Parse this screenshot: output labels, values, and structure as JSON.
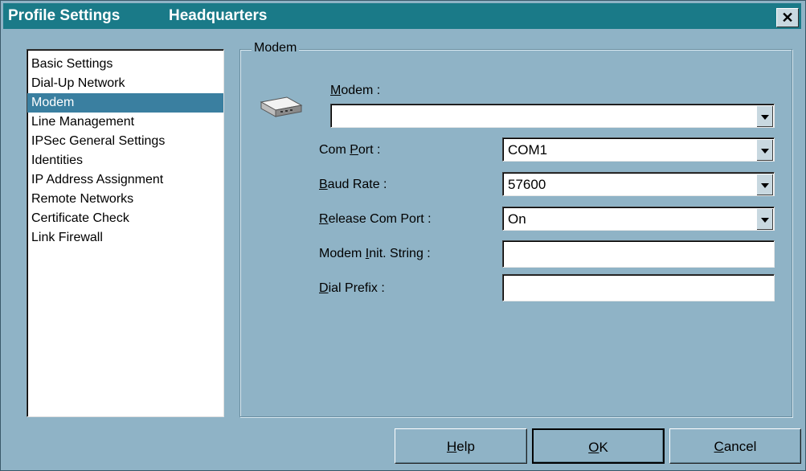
{
  "window": {
    "title_left": "Profile Settings",
    "title_right": "Headquarters",
    "close_glyph": "✕"
  },
  "nav": {
    "items": [
      {
        "label": "Basic Settings"
      },
      {
        "label": "Dial-Up Network"
      },
      {
        "label": "Modem",
        "selected": true
      },
      {
        "label": "Line Management"
      },
      {
        "label": "IPSec General Settings"
      },
      {
        "label": "Identities"
      },
      {
        "label": "IP Address Assignment"
      },
      {
        "label": "Remote Networks"
      },
      {
        "label": "Certificate Check"
      },
      {
        "label": "Link Firewall"
      }
    ]
  },
  "modem_group": {
    "title": "Modem",
    "icon": "modem-icon",
    "modem_label_accel": "M",
    "modem_label_rest": "odem :",
    "modem_value": "",
    "com_port_label_a": "Com ",
    "com_port_label_accel": "P",
    "com_port_label_b": "ort :",
    "com_port_value": "COM1",
    "baud_label_accel": "B",
    "baud_label_rest": "aud Rate :",
    "baud_value": "57600",
    "release_label_accel": "R",
    "release_label_rest": "elease Com Port :",
    "release_value": "On",
    "init_label_a": "Modem ",
    "init_label_accel": "I",
    "init_label_b": "nit. String :",
    "init_value": "",
    "dial_label_accel": "D",
    "dial_label_rest": "ial Prefix :",
    "dial_value": ""
  },
  "buttons": {
    "help_accel": "H",
    "help_rest": "elp",
    "ok_accel": "O",
    "ok_rest": "K",
    "cancel_accel": "C",
    "cancel_rest": "ancel"
  }
}
